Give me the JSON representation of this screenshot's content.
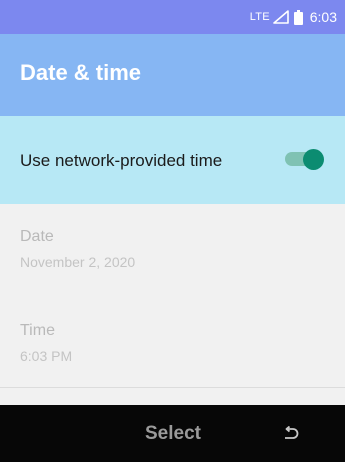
{
  "status_bar": {
    "network": "LTE",
    "time": "6:03",
    "icons": [
      "signal-icon",
      "battery-icon"
    ]
  },
  "header": {
    "title": "Date & time"
  },
  "settings": {
    "network_time": {
      "label": "Use network-provided time",
      "toggle_on": true
    },
    "date": {
      "title": "Date",
      "value": "November 2, 2020"
    },
    "time": {
      "title": "Time",
      "value": "6:03 PM"
    }
  },
  "softkeys": {
    "center": "Select",
    "right_icon": "back-icon"
  },
  "colors": {
    "status_bar": "#7c88ef",
    "header": "#86b6f3",
    "highlight": "#b7e8f5",
    "toggle_thumb": "#0c8c71",
    "toggle_track": "#7fc2b3",
    "softkey_bar": "#070707"
  }
}
